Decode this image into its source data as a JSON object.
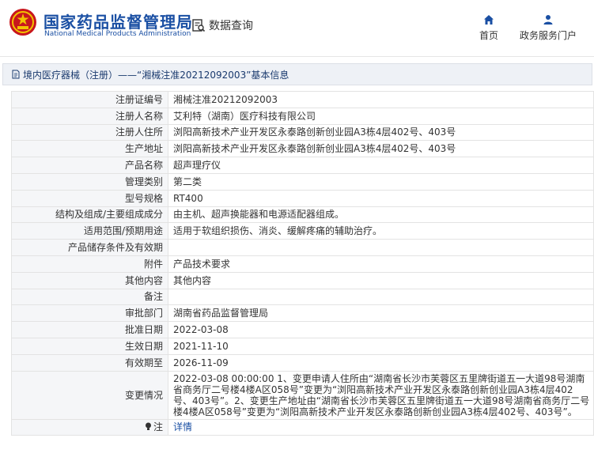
{
  "header": {
    "site_name_cn": "国家药品监督管理局",
    "site_name_en": "National Medical Products Administration",
    "query_label": "数据查询",
    "nav": [
      {
        "label": "首页",
        "icon": "home-icon"
      },
      {
        "label": "政务服务门户",
        "icon": "user-icon"
      }
    ]
  },
  "breadcrumb": {
    "text": "境内医疗器械（注册）——“湘械注准20212092003”基本信息"
  },
  "record": {
    "rows": [
      {
        "label": "注册证编号",
        "value": "湘械注准20212092003"
      },
      {
        "label": "注册人名称",
        "value": "艾利特（湖南）医疗科技有限公司"
      },
      {
        "label": "注册人住所",
        "value": "浏阳高新技术产业开发区永泰路创新创业园A3栋4层402号、403号"
      },
      {
        "label": "生产地址",
        "value": "浏阳高新技术产业开发区永泰路创新创业园A3栋4层402号、403号"
      },
      {
        "label": "产品名称",
        "value": "超声理疗仪"
      },
      {
        "label": "管理类别",
        "value": "第二类"
      },
      {
        "label": "型号规格",
        "value": "RT400"
      },
      {
        "label": "结构及组成/主要组成成分",
        "value": "由主机、超声换能器和电源适配器组成。"
      },
      {
        "label": "适用范围/预期用途",
        "value": "适用于软组织损伤、消炎、缓解疼痛的辅助治疗。"
      },
      {
        "label": "产品储存条件及有效期",
        "value": ""
      },
      {
        "label": "附件",
        "value": "产品技术要求"
      },
      {
        "label": "其他内容",
        "value": "其他内容"
      },
      {
        "label": "备注",
        "value": ""
      },
      {
        "label": "审批部门",
        "value": "湖南省药品监督管理局"
      },
      {
        "label": "批准日期",
        "value": "2022-03-08"
      },
      {
        "label": "生效日期",
        "value": "2021-11-10"
      },
      {
        "label": "有效期至",
        "value": "2026-11-09"
      }
    ],
    "change": {
      "label": "变更情况",
      "value": "2022-03-08 00:00:00 1、变更申请人住所由“湖南省长沙市芙蓉区五里牌街道五一大道98号湖南省商务厅二号楼4楼A区058号”变更为“浏阳高新技术产业开发区永泰路创新创业园A3栋4层402号、403号”。2、变更生产地址由“湖南省长沙市芙蓉区五里牌街道五一大道98号湖南省商务厅二号楼4楼A区058号”变更为“浏阳高新技术产业开发区永泰路创新创业园A3栋4层402号、403号”。"
    },
    "note": {
      "label": "注",
      "link": "详情"
    }
  }
}
